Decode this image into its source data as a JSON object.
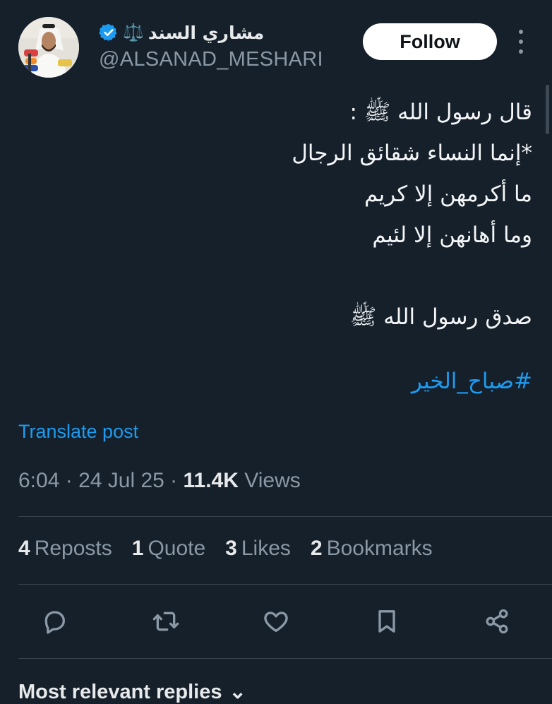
{
  "author": {
    "display_name": "مشاري السند",
    "name_emoji": "⚖️",
    "verified_icon": "verified-badge-icon",
    "handle": "@ALSANAD_MESHARI",
    "avatar": "avatar-photo"
  },
  "header": {
    "follow_label": "Follow",
    "more_icon": "more-vertical-icon"
  },
  "post": {
    "lines": [
      "قال رسول الله ﷺ :",
      "*إنما النساء شقائق الرجال",
      "ما أكرمهن إلا كريم",
      "وما أهانهن إلا لئيم",
      "",
      "صدق رسول الله ﷺ"
    ],
    "hashtag": "#صباح_الخير",
    "translate_label": "Translate post"
  },
  "meta": {
    "time": "6:04",
    "date": "24 Jul 25",
    "views_count": "11.4K",
    "views_label": "Views"
  },
  "stats": [
    {
      "count": "4",
      "label": "Reposts"
    },
    {
      "count": "1",
      "label": "Quote"
    },
    {
      "count": "3",
      "label": "Likes"
    },
    {
      "count": "2",
      "label": "Bookmarks"
    }
  ],
  "actions": [
    "reply-icon",
    "repost-icon",
    "like-icon",
    "bookmark-icon",
    "share-icon"
  ],
  "replies": {
    "title": "Most relevant replies",
    "chevron_icon": "chevron-down-icon"
  },
  "colors": {
    "background": "#15202b",
    "accent": "#1d9bf0",
    "text": "#e7e9ea",
    "muted": "#8b98a5"
  }
}
